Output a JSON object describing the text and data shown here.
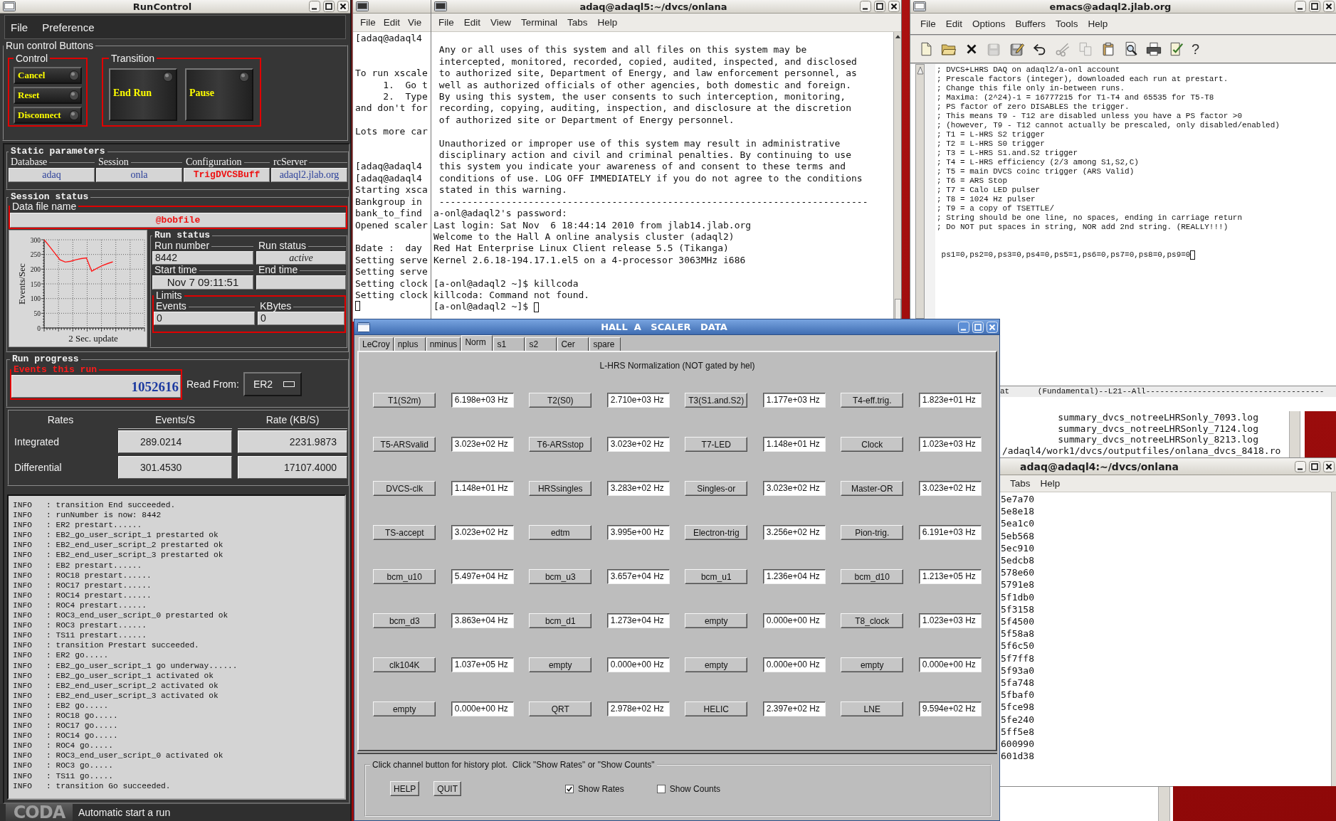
{
  "run_control": {
    "title": "RunControl",
    "menu": [
      "File",
      "Preference"
    ],
    "buttons_panel": "Run control Buttons",
    "control": {
      "label": "Control",
      "buttons": [
        "Cancel",
        "Reset",
        "Disconnect"
      ]
    },
    "transition": {
      "label": "Transition",
      "buttons": [
        "End Run",
        "Pause"
      ]
    },
    "static_parameters": {
      "label": "Static parameters",
      "fields": [
        {
          "label": "Database",
          "value": "adaq",
          "kind": "info"
        },
        {
          "label": "Session",
          "value": "onla",
          "kind": "info"
        },
        {
          "label": "Configuration",
          "value": "TrigDVCSBuff",
          "kind": "alert"
        },
        {
          "label": "rcServer",
          "value": "adaql2.jlab.org",
          "kind": "info"
        }
      ]
    },
    "session_status": {
      "label": "Session status",
      "data_file": {
        "label": "Data file name",
        "value": "@bobfile"
      },
      "chart_data": {
        "type": "line",
        "xlabel": "2 Sec. update",
        "ylabel": "Events/Sec",
        "ylim": [
          0,
          300
        ],
        "yticks": [
          0,
          50,
          100,
          150,
          200,
          250,
          300
        ],
        "grid": true,
        "values": [
          300,
          278,
          255,
          232,
          224,
          227,
          232,
          236,
          238,
          193,
          203,
          212,
          219,
          225,
          null,
          null,
          null,
          null,
          null,
          null
        ]
      },
      "run_status": {
        "label": "Run status",
        "run_number": {
          "label": "Run number",
          "value": "8442"
        },
        "state": {
          "label": "Run status",
          "value": "active"
        },
        "start_time": {
          "label": "Start time",
          "value": "Nov 7 09:11:51"
        },
        "end_time": {
          "label": "End time"
        },
        "limits": {
          "label": "Limits",
          "fields": [
            {
              "label": "Events",
              "value": "0"
            },
            {
              "label": "KBytes",
              "value": "0"
            }
          ]
        }
      }
    },
    "run_progress": {
      "label": "Run progress",
      "events": {
        "label": "Events this run",
        "value": "1052616"
      },
      "read_from": {
        "label": "Read From:",
        "value": "ER2"
      }
    },
    "rates": {
      "columns": [
        "Rates",
        "Events/S",
        "Rate (KB/S)"
      ],
      "rows": [
        {
          "label": "Integrated",
          "events": "289.0214",
          "kbytes": "2231.9873"
        },
        {
          "label": "Differential",
          "events": "301.4530",
          "kbytes": "17107.4000"
        }
      ]
    },
    "log": [
      "INFO   : transition End succeeded.",
      "INFO   : runNumber is now: 8442",
      "INFO   : ER2 prestart......",
      "INFO   : EB2_go_user_script_1 prestarted ok",
      "INFO   : EB2_end_user_script_2 prestarted ok",
      "INFO   : EB2_end_user_script_3 prestarted ok",
      "INFO   : EB2 prestart......",
      "INFO   : ROC18 prestart......",
      "INFO   : ROC17 prestart......",
      "INFO   : ROC14 prestart......",
      "INFO   : ROC4 prestart......",
      "INFO   : ROC3_end_user_script_0 prestarted ok",
      "INFO   : ROC3 prestart......",
      "INFO   : TS11 prestart......",
      "INFO   : transition Prestart succeeded.",
      "INFO   : ER2 go.....",
      "INFO   : EB2_go_user_script_1 go underway......",
      "INFO   : EB2_go_user_script_1 activated ok",
      "INFO   : EB2_end_user_script_2 activated ok",
      "INFO   : EB2_end_user_script_3 activated ok",
      "INFO   : EB2 go.....",
      "INFO   : ROC18 go.....",
      "INFO   : ROC17 go.....",
      "INFO   : ROC14 go.....",
      "INFO   : ROC4 go.....",
      "INFO   : ROC3_end_user_script_0 activated ok",
      "INFO   : ROC3 go.....",
      "INFO   : TS11 go.....",
      "INFO   : transition Go succeeded."
    ],
    "status_bar": {
      "logo": "CODA",
      "message": "Automatic start a run"
    }
  },
  "terminal_left": {
    "menu": [
      "File",
      "Edit",
      "Vie"
    ],
    "output": "[adaq@adaql4\n\n\nTo run xscale\n     1.  Go t\n     2.  Type\nand don't for\n\nLots more car\n\n\n[adaq@adaql4\n[adaq@adaql4\nStarting xsca\nBankgroup in\nbank_to_find\nOpened scaler\n\nBdate :  day\nSetting serve\nSetting serve\nSetting clock\nSetting clock"
  },
  "terminal_main": {
    "title": "adaq@adaql5:~/dvcs/onlana",
    "menu": [
      "File",
      "Edit",
      "View",
      "Terminal",
      "Tabs",
      "Help"
    ],
    "output": "\n Any or all uses of this system and all files on this system may be\n intercepted, monitored, recorded, copied, audited, inspected, and disclosed\n to authorized site, Department of Energy, and law enforcement personnel, as\n well as authorized officials of other agencies, both domestic and foreign.\n By using this system, the user consents to such interception, monitoring,\n recording, copying, auditing, inspection, and disclosure at the discretion\n of authorized site or Department of Energy personnel.\n\n Unauthorized or improper use of this system may result in administrative\n disciplinary action and civil and criminal penalties. By continuing to use\n this system you indicate your awareness of and consent to these terms and\n conditions of use. LOG OFF IMMEDIATELY if you do not agree to the conditions\n stated in this warning.\n -----------------------------------------------------------------------------\na-onl@adaql2's password:\nLast login: Sat Nov  6 18:44:14 2010 from jlab14.jlab.org\nWelcome to the Hall A online analysis cluster (adaql2)\nRed Hat Enterprise Linux Client release 5.5 (Tikanga)\nKernel 2.6.18-194.17.1.el5 on a 4-processor 3063MHz i686\n\n[a-onl@adaql2 ~]$ killcoda\nkillcoda: Command not found.",
    "prompt": "[a-onl@adaql2 ~]$"
  },
  "emacs": {
    "title": "emacs@adaql2.jlab.org",
    "menu": [
      "File",
      "Edit",
      "Options",
      "Buffers",
      "Tools",
      "Help"
    ],
    "toolbar": [
      {
        "kind": "new",
        "disabled": false
      },
      {
        "kind": "open",
        "disabled": false
      },
      {
        "kind": "close",
        "disabled": false
      },
      {
        "kind": "save",
        "disabled": true
      },
      {
        "kind": "save_as",
        "disabled": false
      },
      {
        "kind": "undo",
        "disabled": false
      },
      {
        "kind": "cut",
        "disabled": true
      },
      {
        "kind": "copy",
        "disabled": true
      },
      {
        "kind": "paste",
        "disabled": false
      },
      {
        "kind": "search",
        "disabled": false
      },
      {
        "kind": "print",
        "disabled": false
      },
      {
        "kind": "spell",
        "disabled": false
      },
      {
        "kind": "help",
        "label": "?",
        "disabled": false
      }
    ],
    "comments": "; DVCS+LHRS DAQ on adaql2/a-onl account\n; Prescale factors (integer), downloaded each run at prestart.\n; Change this file only in-between runs.\n; Maxima: (2^24)-1 = 16777215 for T1-T4 and 65535 for T5-T8\n; PS factor of zero DISABLES the trigger.\n; This means T9 - T12 are disabled unless you have a PS factor >0\n; (however, T9 - T12 cannot actually be prescaled, only disabled/enabled)\n; T1 = L-HRS S2 trigger\n; T2 = L-HRS S0 trigger\n; T3 = L-HRS S1.and.S2 trigger\n; T4 = L-HRS efficiency (2/3 among S1,S2,C)\n; T5 = main DVCS coinc trigger (ARS Valid)\n; T6 = ARS Stop\n; T7 = Calo LED pulser\n; T8 = 1024 Hz pulser\n; T9 = a copy of TSETTLE/\n; String should be one line, no spaces, ending in carriage return\n; Do NOT put spaces in string, NOR add 2nd string. (REALLY!!!)",
    "value_line": " ps1=0,ps2=0,ps3=0,ps4=0,ps5=1,ps6=0,ps7=0,ps8=0,ps9=0",
    "mode_line": "at      (Fundamental)--L21--All--------------------------------------"
  },
  "terminal_back": {
    "lines": [
      "          summary_dvcs_notreeLHRSonly_7093.log",
      "          summary_dvcs_notreeLHRSonly_7124.log",
      "          summary_dvcs_notreeLHRSonly_8213.log",
      "/adaql4/work1/dvcs/outputfiles/onlana_dvcs_8418.ro"
    ]
  },
  "terminal_adaql4": {
    "title": "adaq@adaql4:~/dvcs/onlana",
    "menu": [
      "Tabs",
      "Help"
    ],
    "lines": [
      "5e7a70",
      "5e8e18",
      "5ea1c0",
      "5eb568",
      "5ec910",
      "5edcb8",
      "578e60",
      "5791e8",
      "5f1db0",
      "5f3158",
      "5f4500",
      "5f58a8",
      "5f6c50",
      "5f7ff8",
      "5f93a0",
      "5fa748",
      "5fbaf0",
      "5fce98",
      "5fe240",
      "5ff5e8",
      "600990",
      "601d38"
    ]
  },
  "scaler": {
    "title": "HALL  A   SCALER   DATA",
    "tabs": [
      {
        "label": "LeCroy",
        "selected": false
      },
      {
        "label": "nplus",
        "selected": false
      },
      {
        "label": "nminus",
        "selected": false
      },
      {
        "label": "Norm",
        "selected": true
      },
      {
        "label": "s1",
        "selected": false
      },
      {
        "label": "s2",
        "selected": false
      },
      {
        "label": "Cer",
        "selected": false
      },
      {
        "label": "spare",
        "selected": false
      }
    ],
    "heading": "L-HRS Normalization (NOT gated by hel)",
    "channels": [
      {
        "name": "T1(S2m)",
        "rate": "6.198e+03 Hz"
      },
      {
        "name": "T2(S0)",
        "rate": "2.710e+03 Hz"
      },
      {
        "name": "T3(S1.and.S2)",
        "rate": "1.177e+03 Hz"
      },
      {
        "name": "T4-eff.trig.",
        "rate": "1.823e+01 Hz"
      },
      {
        "name": "T5-ARSvalid",
        "rate": "3.023e+02 Hz"
      },
      {
        "name": "T6-ARSstop",
        "rate": "3.023e+02 Hz"
      },
      {
        "name": "T7-LED",
        "rate": "1.148e+01 Hz"
      },
      {
        "name": "Clock",
        "rate": "1.023e+03 Hz"
      },
      {
        "name": "DVCS-clk",
        "rate": "1.148e+01 Hz"
      },
      {
        "name": "HRSsingles",
        "rate": "3.283e+02 Hz"
      },
      {
        "name": "Singles-or",
        "rate": "3.023e+02 Hz"
      },
      {
        "name": "Master-OR",
        "rate": "3.023e+02 Hz"
      },
      {
        "name": "TS-accept",
        "rate": "3.023e+02 Hz"
      },
      {
        "name": "edtm",
        "rate": "3.995e+00 Hz"
      },
      {
        "name": "Electron-trig",
        "rate": "3.256e+02 Hz"
      },
      {
        "name": "Pion-trig.",
        "rate": "6.191e+03 Hz"
      },
      {
        "name": "bcm_u10",
        "rate": "5.497e+04 Hz"
      },
      {
        "name": "bcm_u3",
        "rate": "3.657e+04 Hz"
      },
      {
        "name": "bcm_u1",
        "rate": "1.236e+04 Hz"
      },
      {
        "name": "bcm_d10",
        "rate": "1.213e+05 Hz"
      },
      {
        "name": "bcm_d3",
        "rate": "3.863e+04 Hz"
      },
      {
        "name": "bcm_d1",
        "rate": "1.273e+04 Hz"
      },
      {
        "name": "empty",
        "rate": "0.000e+00 Hz"
      },
      {
        "name": "T8_clock",
        "rate": "1.023e+03 Hz"
      },
      {
        "name": "clk104K",
        "rate": "1.037e+05 Hz"
      },
      {
        "name": "empty",
        "rate": "0.000e+00 Hz"
      },
      {
        "name": "empty",
        "rate": "0.000e+00 Hz"
      },
      {
        "name": "empty",
        "rate": "0.000e+00 Hz"
      },
      {
        "name": "empty",
        "rate": "0.000e+00 Hz"
      },
      {
        "name": "QRT",
        "rate": "2.978e+02 Hz"
      },
      {
        "name": "HELIC",
        "rate": "2.397e+02 Hz"
      },
      {
        "name": "LNE",
        "rate": "9.594e+02 Hz"
      }
    ],
    "hint": "Click channel button for history plot.  Click \"Show Rates\" or \"Show Counts\"",
    "buttons": [
      "HELP",
      "QUIT"
    ],
    "options": [
      {
        "label": "Show Rates",
        "checked": true
      },
      {
        "label": "Show Counts",
        "checked": false
      }
    ]
  }
}
